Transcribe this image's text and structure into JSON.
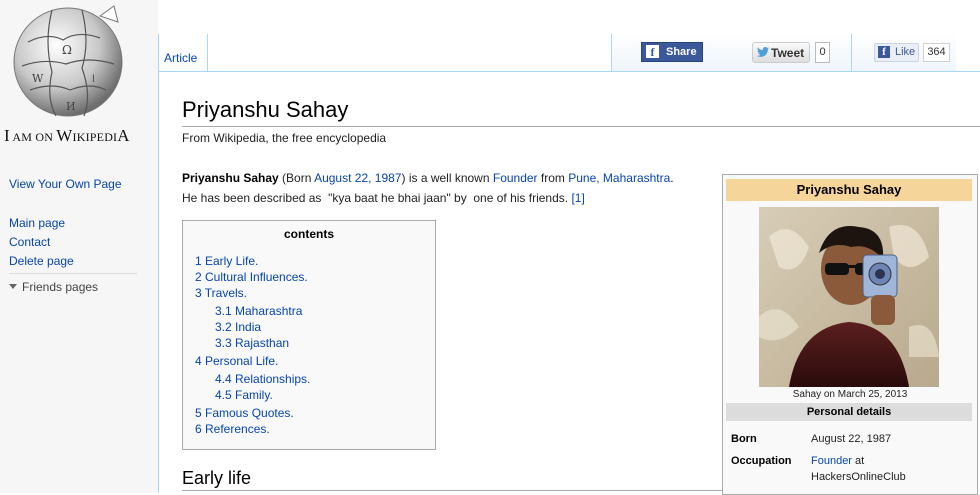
{
  "sidebar": {
    "logo_line": {
      "p1": "I",
      "p2": " am on ",
      "p3": "W",
      "p4": "ikipedi",
      "p5": "A"
    },
    "view_own": "View Your Own Page",
    "links": [
      "Main page",
      "Contact",
      "Delete page"
    ],
    "friends": "Friends pages"
  },
  "tabs": {
    "article": "Article"
  },
  "social": {
    "share_label": "Share",
    "tweet_label": "Tweet",
    "tweet_count": "0",
    "like_label": "Like",
    "like_count": "364"
  },
  "article": {
    "title": "Priyanshu Sahay",
    "tagline": "From Wikipedia, the free encyclopedia",
    "intro": {
      "name": "Priyanshu Sahay",
      "t1": " (Born ",
      "born_date": "August 22, 1987",
      "t2": ") is a well known ",
      "occupation": "Founder",
      "t3": " from ",
      "place": "Pune, Maharashtra",
      "t4": ".",
      "line2": "He has been described as  \"kya baat he bhai jaan\" by  one of his friends. ",
      "ref": "[1]"
    },
    "section_heading": "Early life"
  },
  "toc": {
    "title": "contents",
    "items": [
      "1 Early Life.",
      "2 Cultural Influences.",
      "3 Travels.",
      "3.1 Maharashtra",
      "3.2 India",
      "3.3 Rajasthan",
      "4 Personal Life.",
      "4.4 Relationships.",
      "4.5 Family.",
      "5 Famous Quotes.",
      "6 References."
    ]
  },
  "infobox": {
    "title": "Priyanshu Sahay",
    "caption": "Sahay on March 25, 2013",
    "section": "Personal details",
    "rows": [
      {
        "label": "Born",
        "value": "August 22, 1987"
      },
      {
        "label": "Occupation",
        "value": "Founder",
        "value2": " at",
        "value3": "HackersOnlineClub"
      }
    ]
  },
  "colors": {
    "link": "#0645ad",
    "infobox_header": "#f6d59b",
    "tab_border": "#a7d7f9",
    "facebook": "#3b5998"
  }
}
